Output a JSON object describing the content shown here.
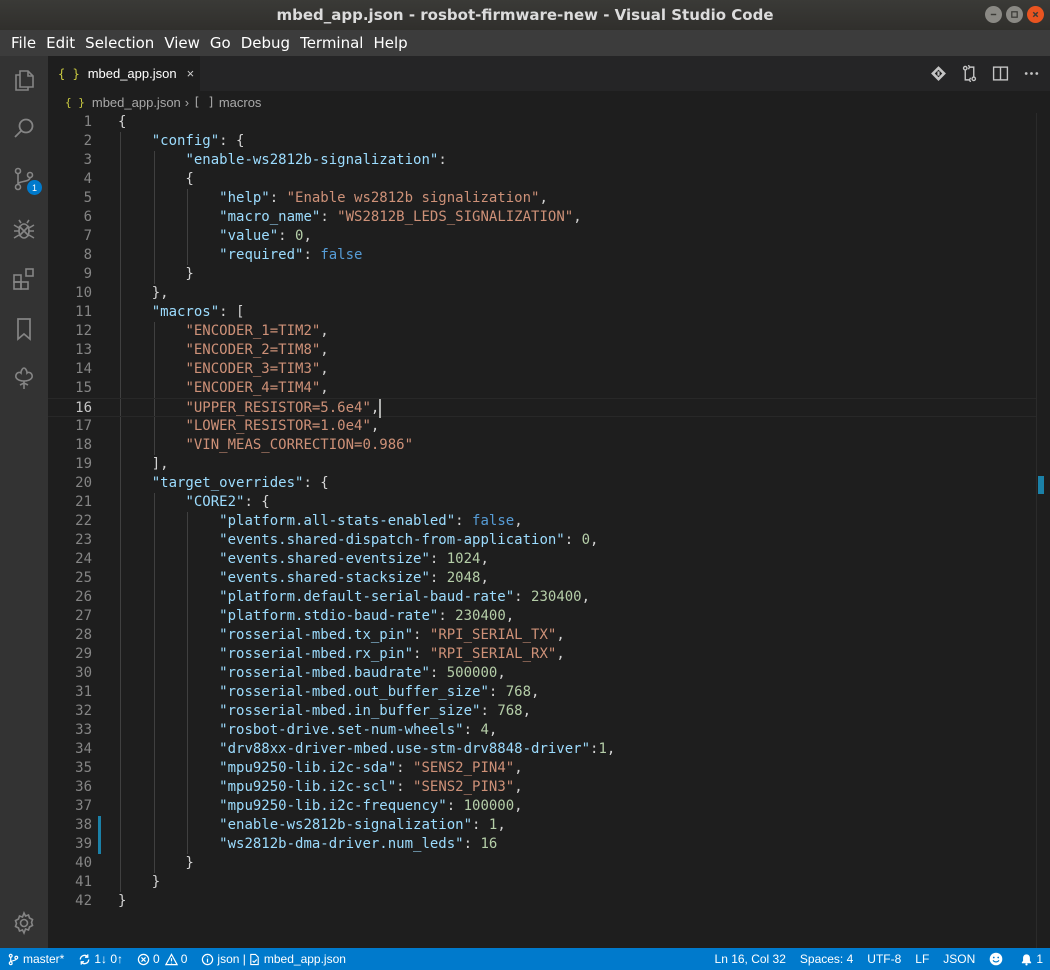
{
  "window": {
    "title": "mbed_app.json - rosbot-firmware-new - Visual Studio Code"
  },
  "menu": [
    "File",
    "Edit",
    "Selection",
    "View",
    "Go",
    "Debug",
    "Terminal",
    "Help"
  ],
  "activity_bar": {
    "items": [
      "files-icon",
      "search-icon",
      "source-control-icon",
      "debug-icon",
      "extensions-icon",
      "bookmarks-icon",
      "tree-icon"
    ],
    "scm_badge": "1",
    "settings": "gear-icon"
  },
  "tab": {
    "icon": "{ }",
    "label": "mbed_app.json",
    "close": "×"
  },
  "breadcrumb": {
    "icon": "{ }",
    "file": "mbed_app.json",
    "symbol_icon": "[ ]",
    "symbol": "macros"
  },
  "editor": {
    "active_line": 16,
    "lines": [
      "{",
      "    \"config\": {",
      "        \"enable-ws2812b-signalization\":",
      "        {",
      "            \"help\": \"Enable ws2812b signalization\",",
      "            \"macro_name\": \"WS2812B_LEDS_SIGNALIZATION\",",
      "            \"value\": 0,",
      "            \"required\": false",
      "        }",
      "    },",
      "    \"macros\": [",
      "        \"ENCODER_1=TIM2\",",
      "        \"ENCODER_2=TIM8\",",
      "        \"ENCODER_3=TIM3\",",
      "        \"ENCODER_4=TIM4\",",
      "        \"UPPER_RESISTOR=5.6e4\",",
      "        \"LOWER_RESISTOR=1.0e4\",",
      "        \"VIN_MEAS_CORRECTION=0.986\"",
      "    ],",
      "    \"target_overrides\": {",
      "        \"CORE2\": {",
      "            \"platform.all-stats-enabled\": false,",
      "            \"events.shared-dispatch-from-application\": 0,",
      "            \"events.shared-eventsize\": 1024,",
      "            \"events.shared-stacksize\": 2048,",
      "            \"platform.default-serial-baud-rate\": 230400,",
      "            \"platform.stdio-baud-rate\": 230400,",
      "            \"rosserial-mbed.tx_pin\": \"RPI_SERIAL_TX\",",
      "            \"rosserial-mbed.rx_pin\": \"RPI_SERIAL_RX\",",
      "            \"rosserial-mbed.baudrate\": 500000,",
      "            \"rosserial-mbed.out_buffer_size\": 768,",
      "            \"rosserial-mbed.in_buffer_size\": 768,",
      "            \"rosbot-drive.set-num-wheels\": 4,",
      "            \"drv88xx-driver-mbed.use-stm-drv8848-driver\":1,",
      "            \"mpu9250-lib.i2c-sda\": \"SENS2_PIN4\",",
      "            \"mpu9250-lib.i2c-scl\": \"SENS2_PIN3\",",
      "            \"mpu9250-lib.i2c-frequency\": 100000,",
      "            \"enable-ws2812b-signalization\": 1,",
      "            \"ws2812b-dma-driver.num_leds\": 16",
      "        }",
      "    }",
      "}"
    ],
    "modified_lines": [
      38,
      39
    ]
  },
  "status": {
    "branch": "master*",
    "sync": "1↓ 0↑",
    "errors": "0",
    "warnings": "0",
    "language_info": "json | ",
    "file_info": "mbed_app.json",
    "position": "Ln 16, Col 32",
    "spaces": "Spaces: 4",
    "encoding": "UTF-8",
    "eol": "LF",
    "language": "JSON",
    "notifications": "1"
  },
  "colors": {
    "accent": "#007acc",
    "key": "#9cdcfe",
    "string": "#ce9178",
    "number": "#b5cea8",
    "boolean": "#569cd6"
  }
}
